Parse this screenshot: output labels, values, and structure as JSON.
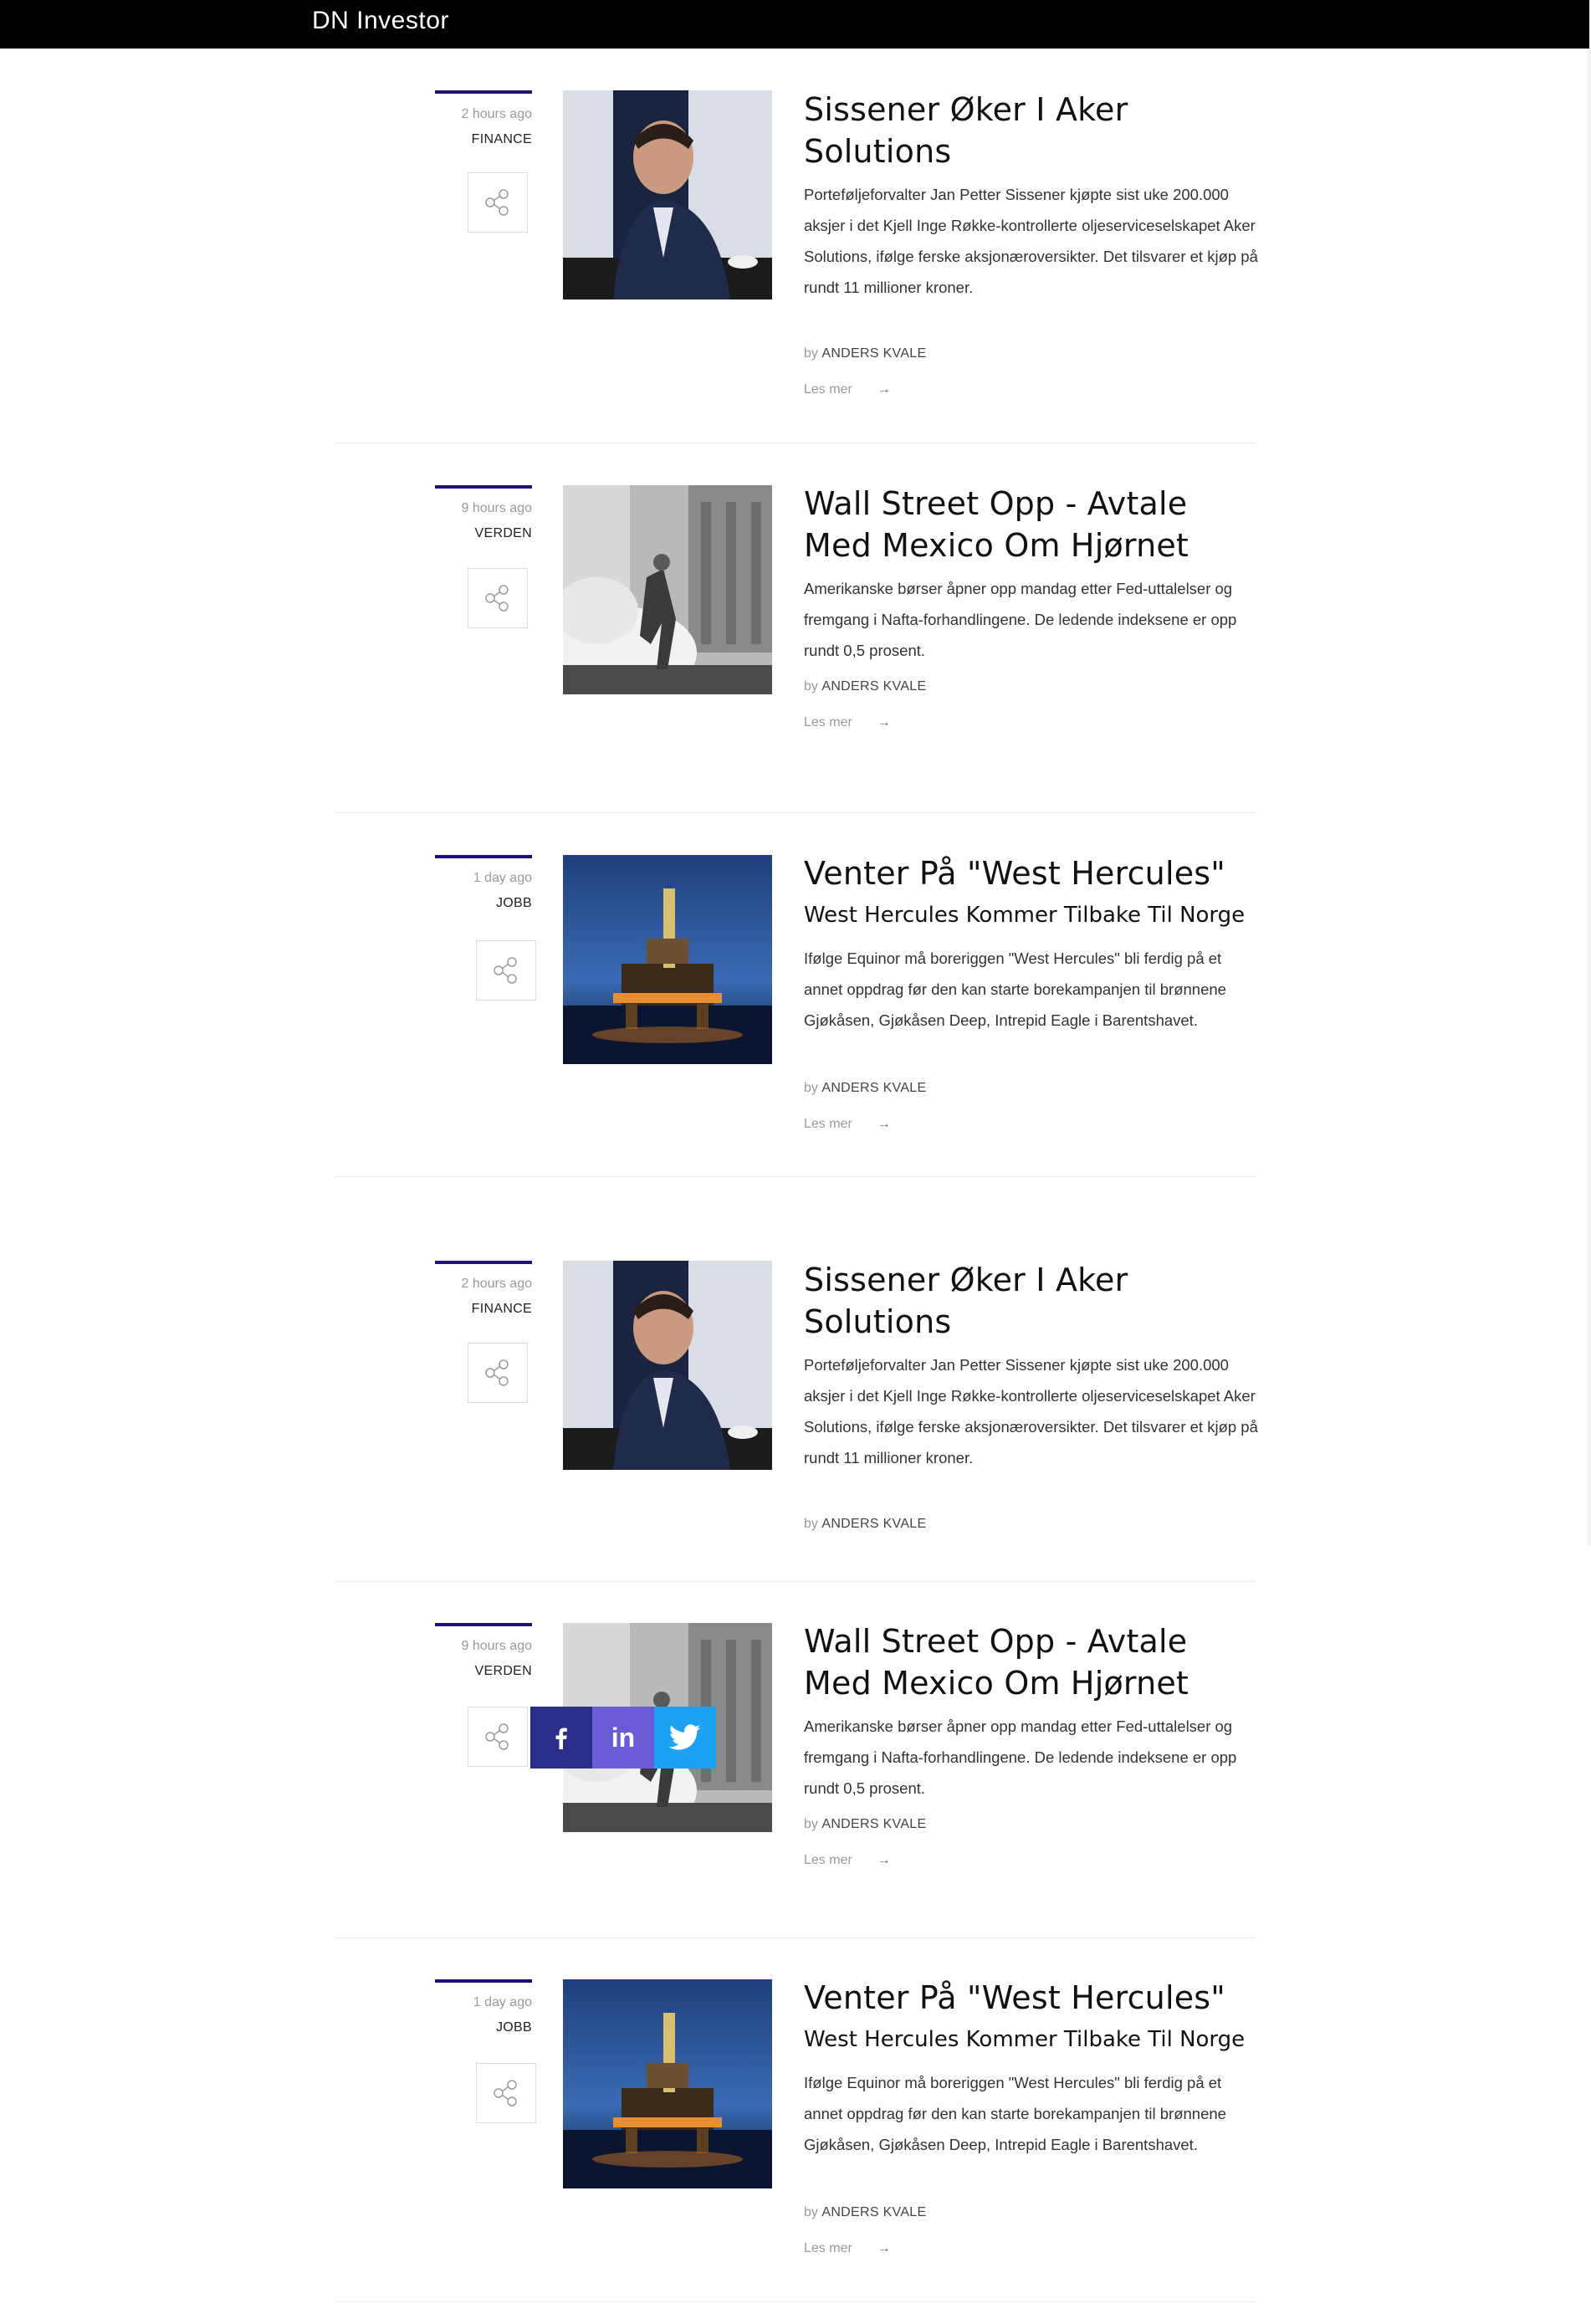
{
  "site": {
    "title": "DN Investor"
  },
  "articles": [
    {
      "time": "2 hours ago",
      "category": "FINANCE",
      "title": "Sissener Øker I Aker Solutions",
      "subtitle": "",
      "description": "Porteføljeforvalter Jan Petter Sissener kjøpte sist uke 200.000 aksjer i det Kjell Inge Røkke-kontrollerte oljeserviceselskapet Aker Solutions, ifølge ferske aksjonæroversikter. Det tilsvarer et kjøp på rundt 11 millioner kroner.",
      "by_label": "by",
      "author": "ANDERS KVALE",
      "read_more": "Les mer",
      "image": "portrait"
    },
    {
      "time": "9 hours ago",
      "category": "VERDEN",
      "title": "Wall Street Opp - Avtale Med Mexico Om Hjørnet",
      "subtitle": "",
      "description": "Amerikanske børser åpner opp mandag etter Fed-uttalelser og fremgang i Nafta-forhandlingene. De ledende indeksene er opp rundt 0,5 prosent.",
      "by_label": "by",
      "author": "ANDERS KVALE",
      "read_more": "Les mer",
      "image": "street"
    },
    {
      "time": "1 day ago",
      "category": "JOBB",
      "title": "Venter På \"West Hercules\"",
      "subtitle": "West Hercules Kommer Tilbake Til Norge",
      "description": "Ifølge Equinor må boreriggen \"West Hercules\" bli ferdig på et annet oppdrag før den kan starte borekampanjen til brønnene Gjøkåsen, Gjøkåsen Deep, Intrepid Eagle i Barentshavet.",
      "by_label": "by",
      "author": "ANDERS KVALE",
      "read_more": "Les mer",
      "image": "rig"
    },
    {
      "time": "2 hours ago",
      "category": "FINANCE",
      "title": "Sissener Øker I Aker Solutions",
      "subtitle": "",
      "description": "Porteføljeforvalter Jan Petter Sissener kjøpte sist uke 200.000 aksjer i det Kjell Inge Røkke-kontrollerte oljeserviceselskapet Aker Solutions, ifølge ferske aksjonæroversikter. Det tilsvarer et kjøp på rundt 11 millioner kroner.",
      "by_label": "by",
      "author": "ANDERS KVALE",
      "read_more": "",
      "image": "portrait"
    },
    {
      "time": "9 hours ago",
      "category": "VERDEN",
      "title": "Wall Street Opp - Avtale Med Mexico Om Hjørnet",
      "subtitle": "",
      "description": "Amerikanske børser åpner opp mandag etter Fed-uttalelser og fremgang i Nafta-forhandlingene. De ledende indeksene er opp rundt 0,5 prosent.",
      "by_label": "by",
      "author": "ANDERS KVALE",
      "read_more": "Les mer",
      "image": "street"
    },
    {
      "time": "1 day ago",
      "category": "JOBB",
      "title": "Venter På \"West Hercules\"",
      "subtitle": "West Hercules Kommer Tilbake Til Norge",
      "description": "Ifølge Equinor må boreriggen \"West Hercules\" bli ferdig på et annet oppdrag før den kan starte borekampanjen til brønnene Gjøkåsen, Gjøkåsen Deep, Intrepid Eagle i Barentshavet.",
      "by_label": "by",
      "author": "ANDERS KVALE",
      "read_more": "Les mer",
      "image": "rig"
    }
  ],
  "share_popup": {
    "facebook_color": "#2b2d8a",
    "linkedin_color": "#6a5bd6",
    "twitter_color": "#1da1f2",
    "icons": [
      "facebook-icon",
      "linkedin-icon",
      "twitter-icon"
    ]
  },
  "colors": {
    "accent": "#25107a",
    "topbar": "#000000"
  }
}
